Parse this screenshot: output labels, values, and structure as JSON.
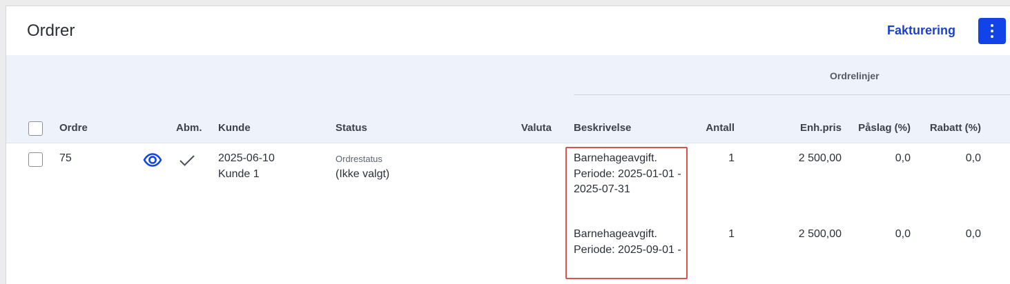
{
  "header": {
    "title": "Ordrer",
    "invoice_link": "Fakturering"
  },
  "table": {
    "group_label": "Ordrelinjer",
    "columns": {
      "ordre": "Ordre",
      "abm": "Abm.",
      "kunde": "Kunde",
      "status": "Status",
      "valuta": "Valuta",
      "beskrivelse": "Beskrivelse",
      "antall": "Antall",
      "enhpris": "Enh.pris",
      "paslag": "Påslag (%)",
      "rabatt": "Rabatt (%)"
    },
    "rows": [
      {
        "order_number": "75",
        "date": "2025-06-10",
        "customer": "Kunde 1",
        "status_label": "Ordrestatus",
        "status_value": "(Ikke valgt)",
        "lines": [
          {
            "description": "Barnehageavgift. Periode: 2025-01-01 - 2025-07-31",
            "antall": "1",
            "enhpris": "2 500,00",
            "paslag": "0,0",
            "rabatt": "0,0"
          },
          {
            "description": "Barnehageavgift. Periode: 2025-09-01 -",
            "antall": "1",
            "enhpris": "2 500,00",
            "paslag": "0,0",
            "rabatt": "0,0"
          }
        ]
      }
    ]
  },
  "icons": {
    "view": "eye-icon",
    "approved": "checkmark-icon",
    "menu": "kebab-menu-icon"
  },
  "colors": {
    "accent": "#1043e8",
    "link": "#1b3fd0",
    "header_band": "#eef2fb",
    "highlight": "#d9534f"
  }
}
